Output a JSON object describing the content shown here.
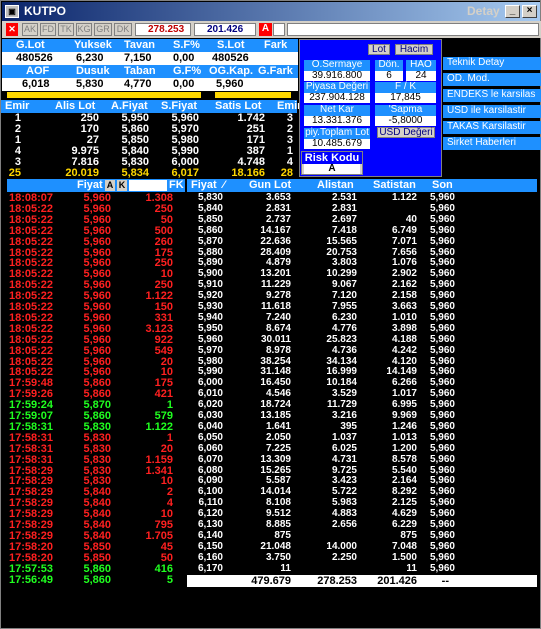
{
  "title": "KUTPO",
  "detay": "Detay",
  "window_buttons": {
    "min": "_",
    "max": "□",
    "close": "×"
  },
  "toolbar": {
    "tools": [
      "AK",
      "FD",
      "TK",
      "KG",
      "GR",
      "DK"
    ],
    "price_a": "278.253",
    "price_b": "201.426",
    "a_btn": "A"
  },
  "summary": {
    "row1_headers": [
      "G.Lot",
      "Yuksek",
      "Tavan",
      "S.F%",
      "S.Lot",
      "Fark"
    ],
    "row1_values": [
      "480526",
      "6,230",
      "7,150",
      "0,00",
      "480526",
      ""
    ],
    "row2_headers": [
      "AOF",
      "Dusuk",
      "Taban",
      "G.F%",
      "OG.Kap.",
      "G.Fark"
    ],
    "row2_values": [
      "6,018",
      "5,830",
      "4,770",
      "0,00",
      "5,960",
      ""
    ]
  },
  "book": {
    "headers": [
      "Emir",
      "Alis Lot",
      "A.Fiyat",
      "S.Fiyat",
      "Satis Lot",
      "Emir"
    ],
    "rows": [
      [
        "1",
        "250",
        "5,950",
        "5,960",
        "1.742",
        "3"
      ],
      [
        "2",
        "170",
        "5,860",
        "5,970",
        "251",
        "2"
      ],
      [
        "1",
        "27",
        "5,850",
        "5,980",
        "171",
        "3"
      ],
      [
        "4",
        "9.975",
        "5,840",
        "5,990",
        "387",
        "1"
      ],
      [
        "3",
        "7.816",
        "5,830",
        "6,000",
        "4.748",
        "4"
      ]
    ],
    "total": [
      "25",
      "20.019",
      "5,834",
      "6,017",
      "18.166",
      "28"
    ]
  },
  "info_panel": {
    "lot_btn": "Lot",
    "hacim_btn": "Hacim",
    "sermaye_label": "O.Sermaye",
    "sermaye_val": "39.916.800",
    "don_label": "Dön.",
    "don_val": "6",
    "hao_label": "HAO",
    "hao_val": "24",
    "piyasa_label": "Piyasa Değeri",
    "piyasa_val": "237.904.128",
    "fk_label": "F / K",
    "fk_val": "17,845",
    "netkar_label": "Net Kar",
    "netkar_val": "13.331.376",
    "sapma_label": "'Sapma",
    "sapma_val": "-5,8000",
    "toplamlot_label": "piy.Toplam Lot",
    "toplamlot_val": "10.485.679",
    "usd_btn": "USD Değeri",
    "risk_label": "Risk Kodu",
    "risk_val": "A"
  },
  "side_buttons": [
    "Teknik Detay",
    "OD. Mod.",
    "ENDEKS le karsilas",
    "USD ile karsilastir",
    "TAKAS Karsilastir",
    "Sirket Haberleri"
  ],
  "trades": {
    "header_fiyat": "Fiyat",
    "header_a": "A",
    "header_k": "K",
    "header_fk": "FK",
    "rows": [
      {
        "t": "18:08:07",
        "p": "5,960",
        "q": "1.308",
        "c": "r"
      },
      {
        "t": "18:05:22",
        "p": "5,960",
        "q": "250",
        "c": "r"
      },
      {
        "t": "18:05:22",
        "p": "5,960",
        "q": "50",
        "c": "r"
      },
      {
        "t": "18:05:22",
        "p": "5,960",
        "q": "500",
        "c": "r"
      },
      {
        "t": "18:05:22",
        "p": "5,960",
        "q": "260",
        "c": "r"
      },
      {
        "t": "18:05:22",
        "p": "5,960",
        "q": "175",
        "c": "r"
      },
      {
        "t": "18:05:22",
        "p": "5,960",
        "q": "250",
        "c": "r"
      },
      {
        "t": "18:05:22",
        "p": "5,960",
        "q": "10",
        "c": "r"
      },
      {
        "t": "18:05:22",
        "p": "5,960",
        "q": "250",
        "c": "r"
      },
      {
        "t": "18:05:22",
        "p": "5,960",
        "q": "1.122",
        "c": "r"
      },
      {
        "t": "18:05:22",
        "p": "5,960",
        "q": "150",
        "c": "r"
      },
      {
        "t": "18:05:22",
        "p": "5,960",
        "q": "331",
        "c": "r"
      },
      {
        "t": "18:05:22",
        "p": "5,960",
        "q": "3.123",
        "c": "r"
      },
      {
        "t": "18:05:22",
        "p": "5,960",
        "q": "922",
        "c": "r"
      },
      {
        "t": "18:05:22",
        "p": "5,960",
        "q": "549",
        "c": "r"
      },
      {
        "t": "18:05:22",
        "p": "5,960",
        "q": "20",
        "c": "r"
      },
      {
        "t": "18:05:22",
        "p": "5,960",
        "q": "10",
        "c": "r"
      },
      {
        "t": "17:59:48",
        "p": "5,860",
        "q": "175",
        "c": "r"
      },
      {
        "t": "17:59:26",
        "p": "5,860",
        "q": "421",
        "c": "r"
      },
      {
        "t": "17:59:24",
        "p": "5,870",
        "q": "1",
        "c": "g"
      },
      {
        "t": "17:59:07",
        "p": "5,860",
        "q": "579",
        "c": "g"
      },
      {
        "t": "17:58:31",
        "p": "5,830",
        "q": "1.122",
        "c": "g"
      },
      {
        "t": "17:58:31",
        "p": "5,830",
        "q": "1",
        "c": "r"
      },
      {
        "t": "17:58:31",
        "p": "5,830",
        "q": "20",
        "c": "r"
      },
      {
        "t": "17:58:31",
        "p": "5,830",
        "q": "1.159",
        "c": "r"
      },
      {
        "t": "17:58:29",
        "p": "5,830",
        "q": "1.341",
        "c": "r"
      },
      {
        "t": "17:58:29",
        "p": "5,830",
        "q": "10",
        "c": "r"
      },
      {
        "t": "17:58:29",
        "p": "5,840",
        "q": "2",
        "c": "r"
      },
      {
        "t": "17:58:29",
        "p": "5,840",
        "q": "4",
        "c": "r"
      },
      {
        "t": "17:58:29",
        "p": "5,840",
        "q": "10",
        "c": "r"
      },
      {
        "t": "17:58:29",
        "p": "5,840",
        "q": "795",
        "c": "r"
      },
      {
        "t": "17:58:29",
        "p": "5,840",
        "q": "1.705",
        "c": "r"
      },
      {
        "t": "17:58:20",
        "p": "5,850",
        "q": "45",
        "c": "r"
      },
      {
        "t": "17:58:20",
        "p": "5,850",
        "q": "50",
        "c": "r"
      },
      {
        "t": "17:57:53",
        "p": "5,860",
        "q": "416",
        "c": "g"
      },
      {
        "t": "17:56:49",
        "p": "5,860",
        "q": "5",
        "c": "g"
      }
    ]
  },
  "depth": {
    "headers": [
      "Fiyat",
      "Gun Lot",
      "Alistan",
      "Satistan",
      "Son"
    ],
    "rows": [
      [
        "5,830",
        "3.653",
        "2.531",
        "1.122",
        "5,960"
      ],
      [
        "5,840",
        "2.831",
        "2.831",
        "",
        "5,960"
      ],
      [
        "5,850",
        "2.737",
        "2.697",
        "40",
        "5,960"
      ],
      [
        "5,860",
        "14.167",
        "7.418",
        "6.749",
        "5,960"
      ],
      [
        "5,870",
        "22.636",
        "15.565",
        "7.071",
        "5,960"
      ],
      [
        "5,880",
        "28.409",
        "20.753",
        "7.656",
        "5,960"
      ],
      [
        "5,890",
        "4.879",
        "3.803",
        "1.076",
        "5,960"
      ],
      [
        "5,900",
        "13.201",
        "10.299",
        "2.902",
        "5,960"
      ],
      [
        "5,910",
        "11.229",
        "9.067",
        "2.162",
        "5,960"
      ],
      [
        "5,920",
        "9.278",
        "7.120",
        "2.158",
        "5,960"
      ],
      [
        "5,930",
        "11.618",
        "7.955",
        "3.663",
        "5,960"
      ],
      [
        "5,940",
        "7.240",
        "6.230",
        "1.010",
        "5,960"
      ],
      [
        "5,950",
        "8.674",
        "4.776",
        "3.898",
        "5,960"
      ],
      [
        "5,960",
        "30.011",
        "25.823",
        "4.188",
        "5,960"
      ],
      [
        "5,970",
        "8.978",
        "4.736",
        "4.242",
        "5,960"
      ],
      [
        "5,980",
        "38.254",
        "34.134",
        "4.120",
        "5,960"
      ],
      [
        "5,990",
        "31.148",
        "16.999",
        "14.149",
        "5,960"
      ],
      [
        "6,000",
        "16.450",
        "10.184",
        "6.266",
        "5,960"
      ],
      [
        "6,010",
        "4.546",
        "3.529",
        "1.017",
        "5,960"
      ],
      [
        "6,020",
        "18.724",
        "11.729",
        "6.995",
        "5,960"
      ],
      [
        "6,030",
        "13.185",
        "3.216",
        "9.969",
        "5,960"
      ],
      [
        "6,040",
        "1.641",
        "395",
        "1.246",
        "5,960"
      ],
      [
        "6,050",
        "2.050",
        "1.037",
        "1.013",
        "5,960"
      ],
      [
        "6,060",
        "7.225",
        "6.025",
        "1.200",
        "5,960"
      ],
      [
        "6,070",
        "13.309",
        "4.731",
        "8.578",
        "5,960"
      ],
      [
        "6,080",
        "15.265",
        "9.725",
        "5.540",
        "5,960"
      ],
      [
        "6,090",
        "5.587",
        "3.423",
        "2.164",
        "5,960"
      ],
      [
        "6,100",
        "14.014",
        "5.722",
        "8.292",
        "5,960"
      ],
      [
        "6,110",
        "8.108",
        "5.983",
        "2.125",
        "5,960"
      ],
      [
        "6,120",
        "9.512",
        "4.883",
        "4.629",
        "5,960"
      ],
      [
        "6,130",
        "8.885",
        "2.656",
        "6.229",
        "5,960"
      ],
      [
        "6,140",
        "875",
        "",
        "875",
        "5,960"
      ],
      [
        "6,150",
        "21.048",
        "14.000",
        "7.048",
        "5,960"
      ],
      [
        "6,160",
        "3.750",
        "2.250",
        "1.500",
        "5,960"
      ],
      [
        "6,170",
        "11",
        "",
        "11",
        "5,960"
      ]
    ],
    "total": [
      "",
      "479.679",
      "278.253",
      "201.426",
      "--"
    ]
  }
}
